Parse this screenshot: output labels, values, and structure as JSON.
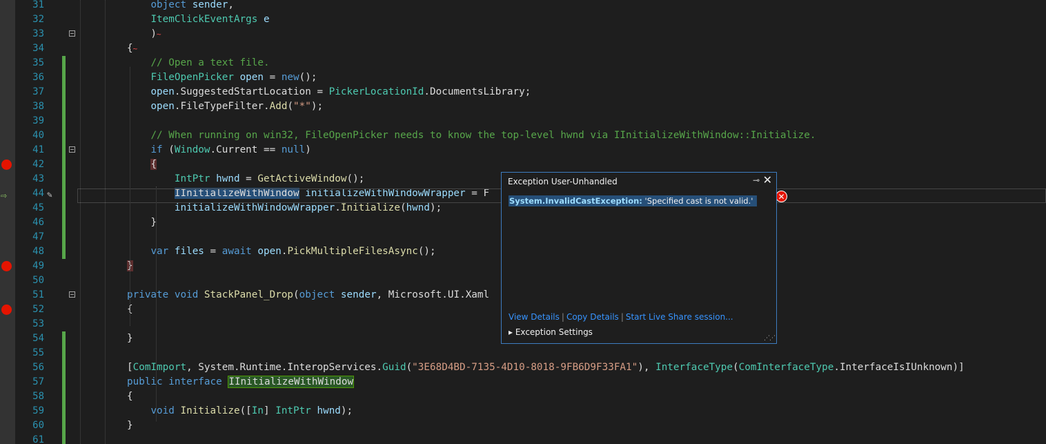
{
  "lines": [
    {
      "n": "31",
      "segs": [
        [
          "pl",
          "    "
        ],
        [
          "kw",
          "object"
        ],
        [
          "pl",
          " "
        ],
        [
          "pm",
          "sender"
        ],
        [
          "pl",
          ","
        ]
      ]
    },
    {
      "n": "32",
      "segs": [
        [
          "pl",
          "    "
        ],
        [
          "ty",
          "ItemClickEventArgs"
        ],
        [
          "pl",
          " "
        ],
        [
          "pm",
          "e"
        ]
      ]
    },
    {
      "n": "33",
      "segs": [
        [
          "pl",
          "    )"
        ],
        [
          "squig",
          "~"
        ]
      ]
    },
    {
      "n": "34",
      "segs": [
        [
          "pl",
          "{"
        ],
        [
          "squig",
          "~"
        ]
      ]
    },
    {
      "n": "35",
      "segs": [
        [
          "pl",
          "    "
        ],
        [
          "cm",
          "// Open a text file."
        ]
      ]
    },
    {
      "n": "36",
      "segs": [
        [
          "pl",
          "    "
        ],
        [
          "ty",
          "FileOpenPicker"
        ],
        [
          "pl",
          " "
        ],
        [
          "pm",
          "open"
        ],
        [
          "pl",
          " = "
        ],
        [
          "kw",
          "new"
        ],
        [
          "pl",
          "();"
        ]
      ]
    },
    {
      "n": "37",
      "segs": [
        [
          "pl",
          "    "
        ],
        [
          "pm",
          "open"
        ],
        [
          "pl",
          ".SuggestedStartLocation = "
        ],
        [
          "ty",
          "PickerLocationId"
        ],
        [
          "pl",
          ".DocumentsLibrary;"
        ]
      ]
    },
    {
      "n": "38",
      "segs": [
        [
          "pl",
          "    "
        ],
        [
          "pm",
          "open"
        ],
        [
          "pl",
          ".FileTypeFilter."
        ],
        [
          "mt",
          "Add"
        ],
        [
          "pl",
          "("
        ],
        [
          "st",
          "\"*\""
        ],
        [
          "pl",
          ");"
        ]
      ]
    },
    {
      "n": "39",
      "segs": []
    },
    {
      "n": "40",
      "segs": [
        [
          "pl",
          "    "
        ],
        [
          "cm",
          "// When running on win32, FileOpenPicker needs to know the top-level hwnd via IInitializeWithWindow::Initialize."
        ]
      ]
    },
    {
      "n": "41",
      "segs": [
        [
          "pl",
          "    "
        ],
        [
          "kw",
          "if"
        ],
        [
          "pl",
          " ("
        ],
        [
          "ty",
          "Window"
        ],
        [
          "pl",
          ".Current == "
        ],
        [
          "kw",
          "null"
        ],
        [
          "pl",
          ")"
        ]
      ]
    },
    {
      "n": "42",
      "segs": [
        [
          "pl",
          "    "
        ],
        [
          "brace-hl",
          "{"
        ]
      ]
    },
    {
      "n": "43",
      "segs": [
        [
          "pl",
          "        "
        ],
        [
          "ty",
          "IntPtr"
        ],
        [
          "pl",
          " "
        ],
        [
          "pm",
          "hwnd"
        ],
        [
          "pl",
          " = "
        ],
        [
          "mt",
          "GetActiveWindow"
        ],
        [
          "pl",
          "();"
        ]
      ]
    },
    {
      "n": "44",
      "segs": [
        [
          "pl",
          "        "
        ],
        [
          "hl-type",
          "IInitializeWithWindow"
        ],
        [
          "pl",
          " "
        ],
        [
          "pm",
          "initializeWithWindowWrapper"
        ],
        [
          "pl",
          " = F"
        ]
      ]
    },
    {
      "n": "45",
      "segs": [
        [
          "pl",
          "        "
        ],
        [
          "pm",
          "initializeWithWindowWrapper"
        ],
        [
          "pl",
          "."
        ],
        [
          "mt",
          "Initialize"
        ],
        [
          "pl",
          "("
        ],
        [
          "pm",
          "hwnd"
        ],
        [
          "pl",
          ");"
        ]
      ]
    },
    {
      "n": "46",
      "segs": [
        [
          "pl",
          "    }"
        ]
      ]
    },
    {
      "n": "47",
      "segs": []
    },
    {
      "n": "48",
      "segs": [
        [
          "pl",
          "    "
        ],
        [
          "kw",
          "var"
        ],
        [
          "pl",
          " "
        ],
        [
          "pm",
          "files"
        ],
        [
          "pl",
          " = "
        ],
        [
          "kw",
          "await"
        ],
        [
          "pl",
          " "
        ],
        [
          "pm",
          "open"
        ],
        [
          "pl",
          "."
        ],
        [
          "mt",
          "PickMultipleFilesAsync"
        ],
        [
          "pl",
          "();"
        ]
      ]
    },
    {
      "n": "49",
      "segs": [
        [
          "brace-hl",
          "}"
        ]
      ]
    },
    {
      "n": "50",
      "segs": []
    },
    {
      "n": "51",
      "segs": [
        [
          "kw",
          "private"
        ],
        [
          "pl",
          " "
        ],
        [
          "kw",
          "void"
        ],
        [
          "pl",
          " "
        ],
        [
          "mt",
          "StackPanel_Drop"
        ],
        [
          "pl",
          "("
        ],
        [
          "kw",
          "object"
        ],
        [
          "pl",
          " "
        ],
        [
          "pm",
          "sender"
        ],
        [
          "pl",
          ", Microsoft.UI.Xaml"
        ]
      ]
    },
    {
      "n": "52",
      "segs": [
        [
          "pl",
          "{"
        ]
      ]
    },
    {
      "n": "53",
      "segs": []
    },
    {
      "n": "54",
      "segs": [
        [
          "pl",
          "}"
        ]
      ]
    },
    {
      "n": "55",
      "segs": []
    },
    {
      "n": "56",
      "segs": [
        [
          "pl",
          "["
        ],
        [
          "ty",
          "ComImport"
        ],
        [
          "pl",
          ", System.Runtime.InteropServices."
        ],
        [
          "ty",
          "Guid"
        ],
        [
          "pl",
          "("
        ],
        [
          "st",
          "\"3E68D4BD-7135-4D10-8018-9FB6D9F33FA1\""
        ],
        [
          "pl",
          "), "
        ],
        [
          "ty",
          "InterfaceType"
        ],
        [
          "pl",
          "("
        ],
        [
          "ty",
          "ComInterfaceType"
        ],
        [
          "pl",
          ".InterfaceIsIUnknown)]"
        ]
      ]
    },
    {
      "n": "57",
      "segs": [
        [
          "kw",
          "public"
        ],
        [
          "pl",
          " "
        ],
        [
          "kw",
          "interface"
        ],
        [
          "pl",
          " "
        ],
        [
          "hl-ref",
          "IInitializeWithWindow"
        ]
      ]
    },
    {
      "n": "58",
      "segs": [
        [
          "pl",
          "{"
        ]
      ]
    },
    {
      "n": "59",
      "segs": [
        [
          "pl",
          "    "
        ],
        [
          "kw",
          "void"
        ],
        [
          "pl",
          " "
        ],
        [
          "mt",
          "Initialize"
        ],
        [
          "pl",
          "(["
        ],
        [
          "ty",
          "In"
        ],
        [
          "pl",
          "] "
        ],
        [
          "ty",
          "IntPtr"
        ],
        [
          "pl",
          " "
        ],
        [
          "pm",
          "hwnd"
        ],
        [
          "pl",
          ");"
        ]
      ]
    },
    {
      "n": "60",
      "segs": [
        [
          "pl",
          "}"
        ]
      ]
    },
    {
      "n": "61",
      "segs": []
    }
  ],
  "exception": {
    "title": "Exception User-Unhandled",
    "pin_icon": "pin-icon",
    "close_icon": "close-icon",
    "exception_type": "System.InvalidCastException:",
    "message": " 'Specified cast is not valid.'",
    "link_view": "View Details",
    "link_copy": "Copy Details",
    "link_liveshare": "Start Live Share session...",
    "settings": "Exception Settings"
  },
  "markers": {
    "breakpoint_lines": [
      "42",
      "49",
      "52"
    ],
    "error_icon_glyph": "✕"
  }
}
